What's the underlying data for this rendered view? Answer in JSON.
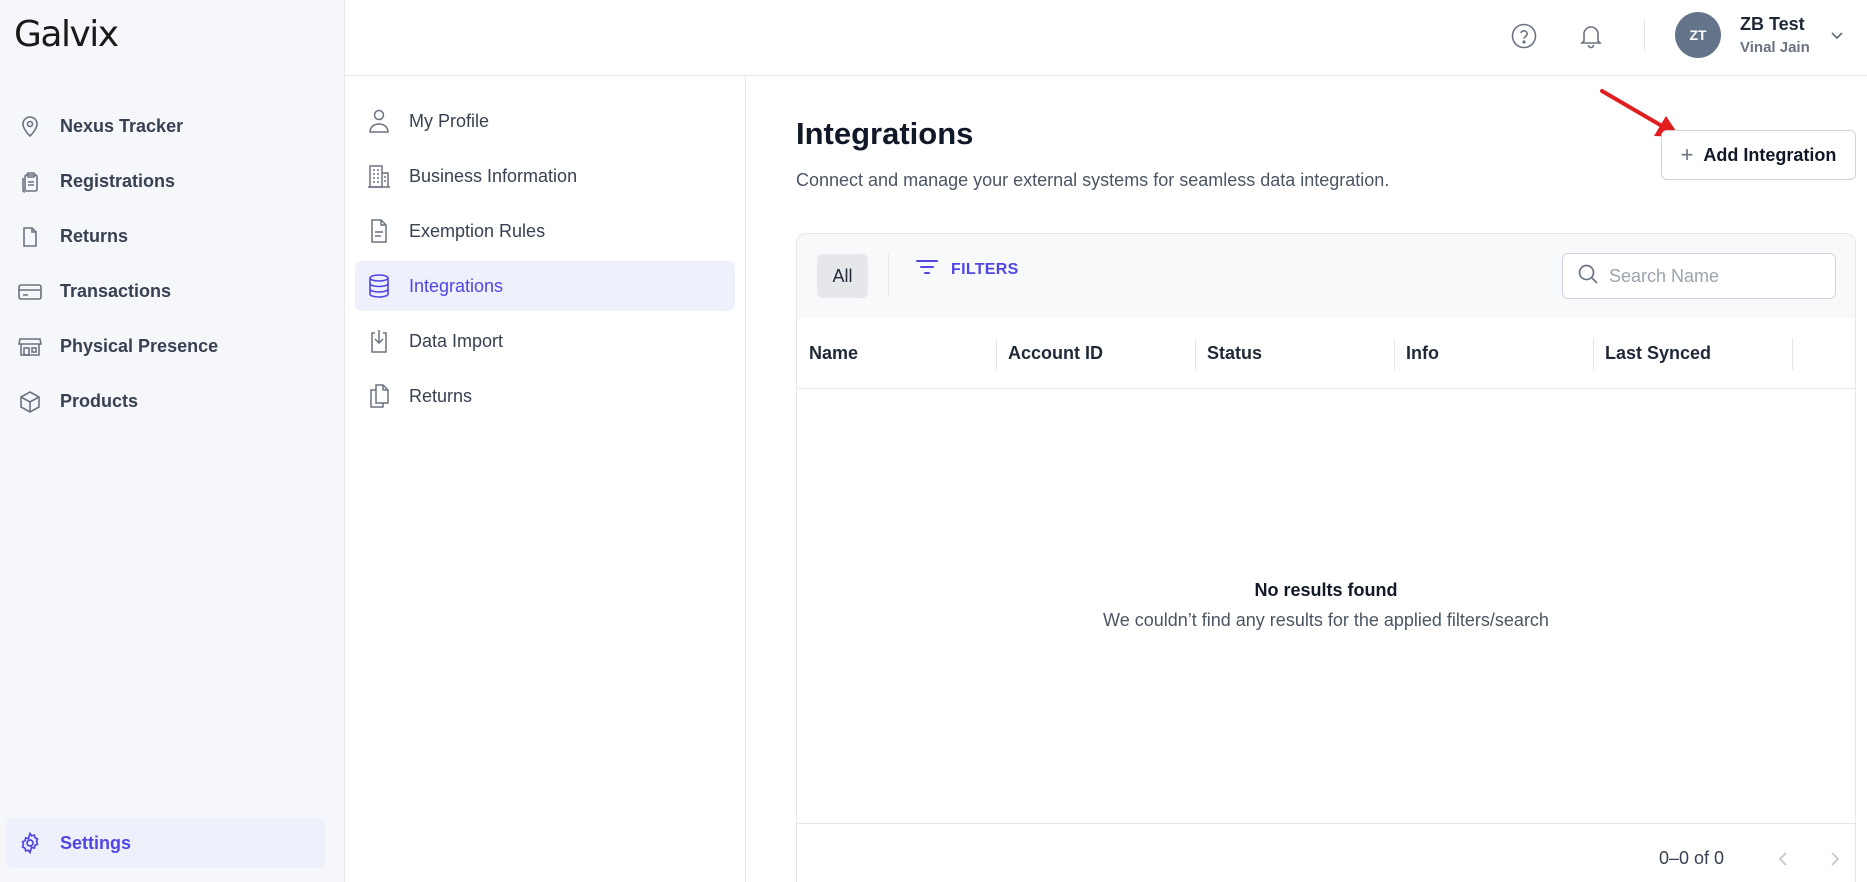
{
  "app": {
    "logo": "Galvix"
  },
  "sidebar": {
    "items": [
      {
        "label": "Nexus Tracker",
        "icon": "location-pin-icon"
      },
      {
        "label": "Registrations",
        "icon": "clipboard-icon"
      },
      {
        "label": "Returns",
        "icon": "document-icon"
      },
      {
        "label": "Transactions",
        "icon": "credit-card-icon"
      },
      {
        "label": "Physical Presence",
        "icon": "store-icon"
      },
      {
        "label": "Products",
        "icon": "box-icon"
      }
    ],
    "settings": {
      "label": "Settings",
      "icon": "gear-icon"
    }
  },
  "topbar": {
    "help_icon": "help-circle-icon",
    "bell_icon": "bell-icon",
    "avatar_initials": "ZT",
    "user_name": "ZB Test",
    "user_sub": "Vinal Jain"
  },
  "settings_nav": {
    "items": [
      {
        "label": "My Profile",
        "icon": "user-icon"
      },
      {
        "label": "Business Information",
        "icon": "building-icon"
      },
      {
        "label": "Exemption Rules",
        "icon": "file-text-icon"
      },
      {
        "label": "Integrations",
        "icon": "database-icon",
        "active": true
      },
      {
        "label": "Data Import",
        "icon": "download-file-icon"
      },
      {
        "label": "Returns",
        "icon": "copy-files-icon"
      }
    ]
  },
  "main": {
    "title": "Integrations",
    "subtitle": "Connect and manage your external systems for seamless data integration.",
    "add_button": "Add Integration",
    "toolbar": {
      "all_chip": "All",
      "filters_label": "FILTERS",
      "search_placeholder": "Search Name"
    },
    "table": {
      "columns": [
        "Name",
        "Account ID",
        "Status",
        "Info",
        "Last Synced"
      ],
      "empty_title": "No results found",
      "empty_message": "We couldn’t find any results for the applied filters/search"
    },
    "pagination": {
      "text": "0–0 of 0"
    }
  },
  "colors": {
    "accent": "#4f46e5",
    "sidebar_bg": "#f6f7fb",
    "active_bg": "#eef1fb",
    "annotation_arrow": "#e11d1d"
  }
}
